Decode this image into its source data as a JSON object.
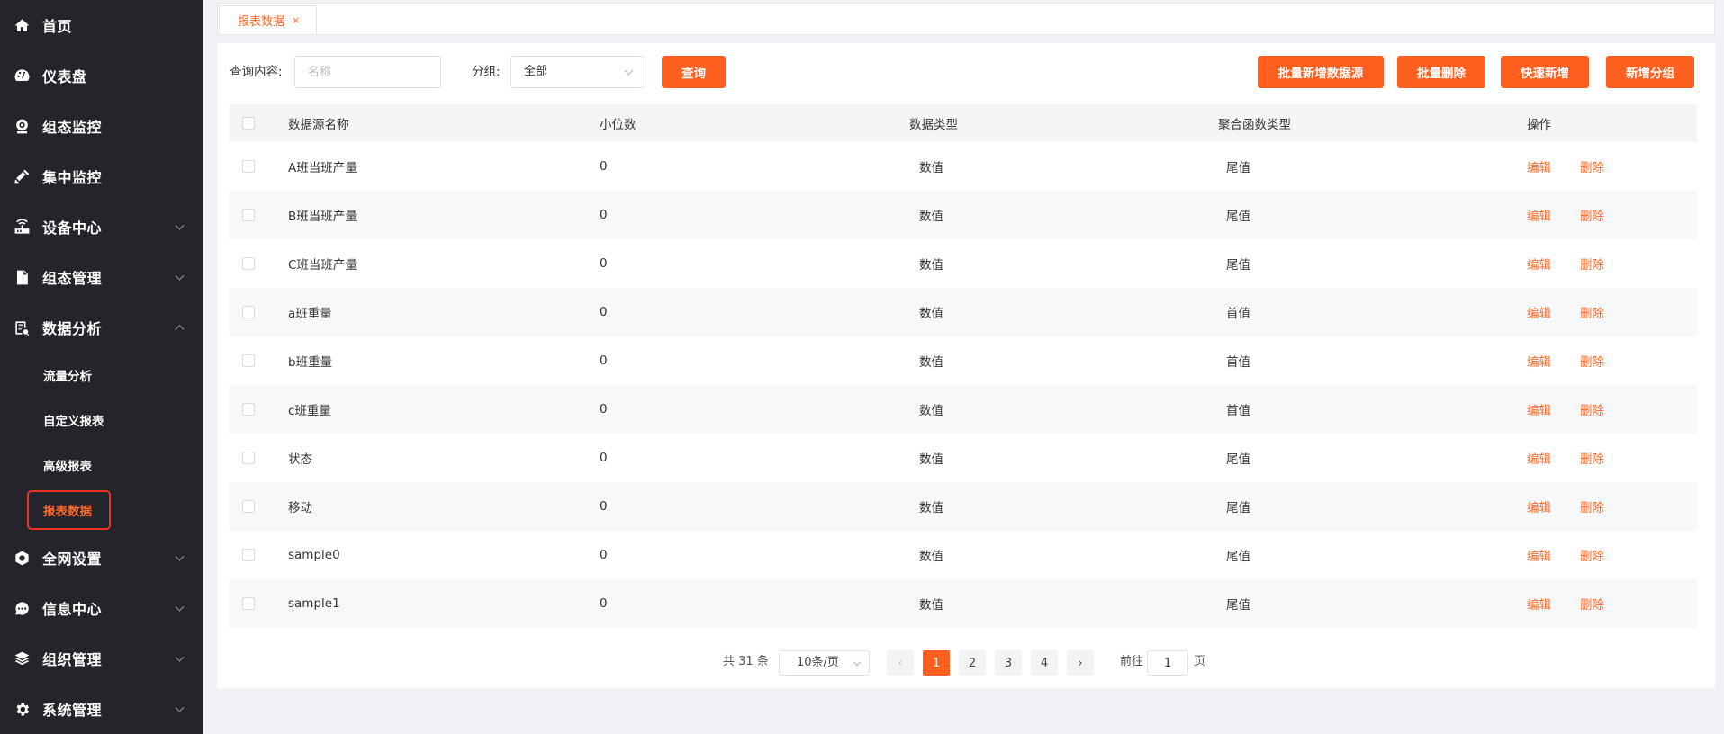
{
  "sidebar": {
    "items": [
      {
        "label": "首页",
        "icon": "home-icon"
      },
      {
        "label": "仪表盘",
        "icon": "dashboard-icon"
      },
      {
        "label": "组态监控",
        "icon": "webcam-icon"
      },
      {
        "label": "集中监控",
        "icon": "monitor-camera-icon"
      },
      {
        "label": "设备中心",
        "icon": "router-icon"
      },
      {
        "label": "组态管理",
        "icon": "document-edit-icon"
      },
      {
        "label": "数据分析",
        "icon": "data-report-icon"
      },
      {
        "label": "全网设置",
        "icon": "network-settings-icon"
      },
      {
        "label": "信息中心",
        "icon": "chat-bubble-icon"
      },
      {
        "label": "组织管理",
        "icon": "layers-icon"
      },
      {
        "label": "系统管理",
        "icon": "gear-icon"
      }
    ],
    "sub_items": [
      "流量分析",
      "自定义报表",
      "高级报表",
      "报表数据"
    ],
    "active_sub": "报表数据"
  },
  "tab": {
    "label": "报表数据",
    "close": "×"
  },
  "toolbar": {
    "query_label": "查询内容:",
    "name_placeholder": "名称",
    "group_label": "分组:",
    "group_value": "全部",
    "query_button": "查询",
    "batch_add_button": "批量新增数据源",
    "batch_delete_button": "批量删除",
    "quick_add_button": "快速新增",
    "add_group_button": "新增分组"
  },
  "table": {
    "headers": [
      "数据源名称",
      "小位数",
      "数据类型",
      "聚合函数类型",
      "操作"
    ],
    "rows": [
      {
        "name": "A班当班产量",
        "decimals": "0",
        "type": "数值",
        "agg": "尾值"
      },
      {
        "name": "B班当班产量",
        "decimals": "0",
        "type": "数值",
        "agg": "尾值"
      },
      {
        "name": "C班当班产量",
        "decimals": "0",
        "type": "数值",
        "agg": "尾值"
      },
      {
        "name": "a班重量",
        "decimals": "0",
        "type": "数值",
        "agg": "首值"
      },
      {
        "name": "b班重量",
        "decimals": "0",
        "type": "数值",
        "agg": "首值"
      },
      {
        "name": "c班重量",
        "decimals": "0",
        "type": "数值",
        "agg": "首值"
      },
      {
        "name": "状态",
        "decimals": "0",
        "type": "数值",
        "agg": "尾值"
      },
      {
        "name": "移动",
        "decimals": "0",
        "type": "数值",
        "agg": "尾值"
      },
      {
        "name": "sample0",
        "decimals": "0",
        "type": "数值",
        "agg": "尾值"
      },
      {
        "name": "sample1",
        "decimals": "0",
        "type": "数值",
        "agg": "尾值"
      }
    ],
    "edit_label": "编辑",
    "delete_label": "删除"
  },
  "pagination": {
    "total": "共 31 条",
    "page_size": "10条/页",
    "pages": [
      "1",
      "2",
      "3",
      "4"
    ],
    "current": "1",
    "goto_label": "前往",
    "goto_value": "1",
    "page_unit": "页",
    "prev": "‹",
    "next": "›"
  },
  "colors": {
    "accent": "#ff5f1f",
    "sidebar_bg": "#25242a",
    "active_outline": "#e73524"
  }
}
